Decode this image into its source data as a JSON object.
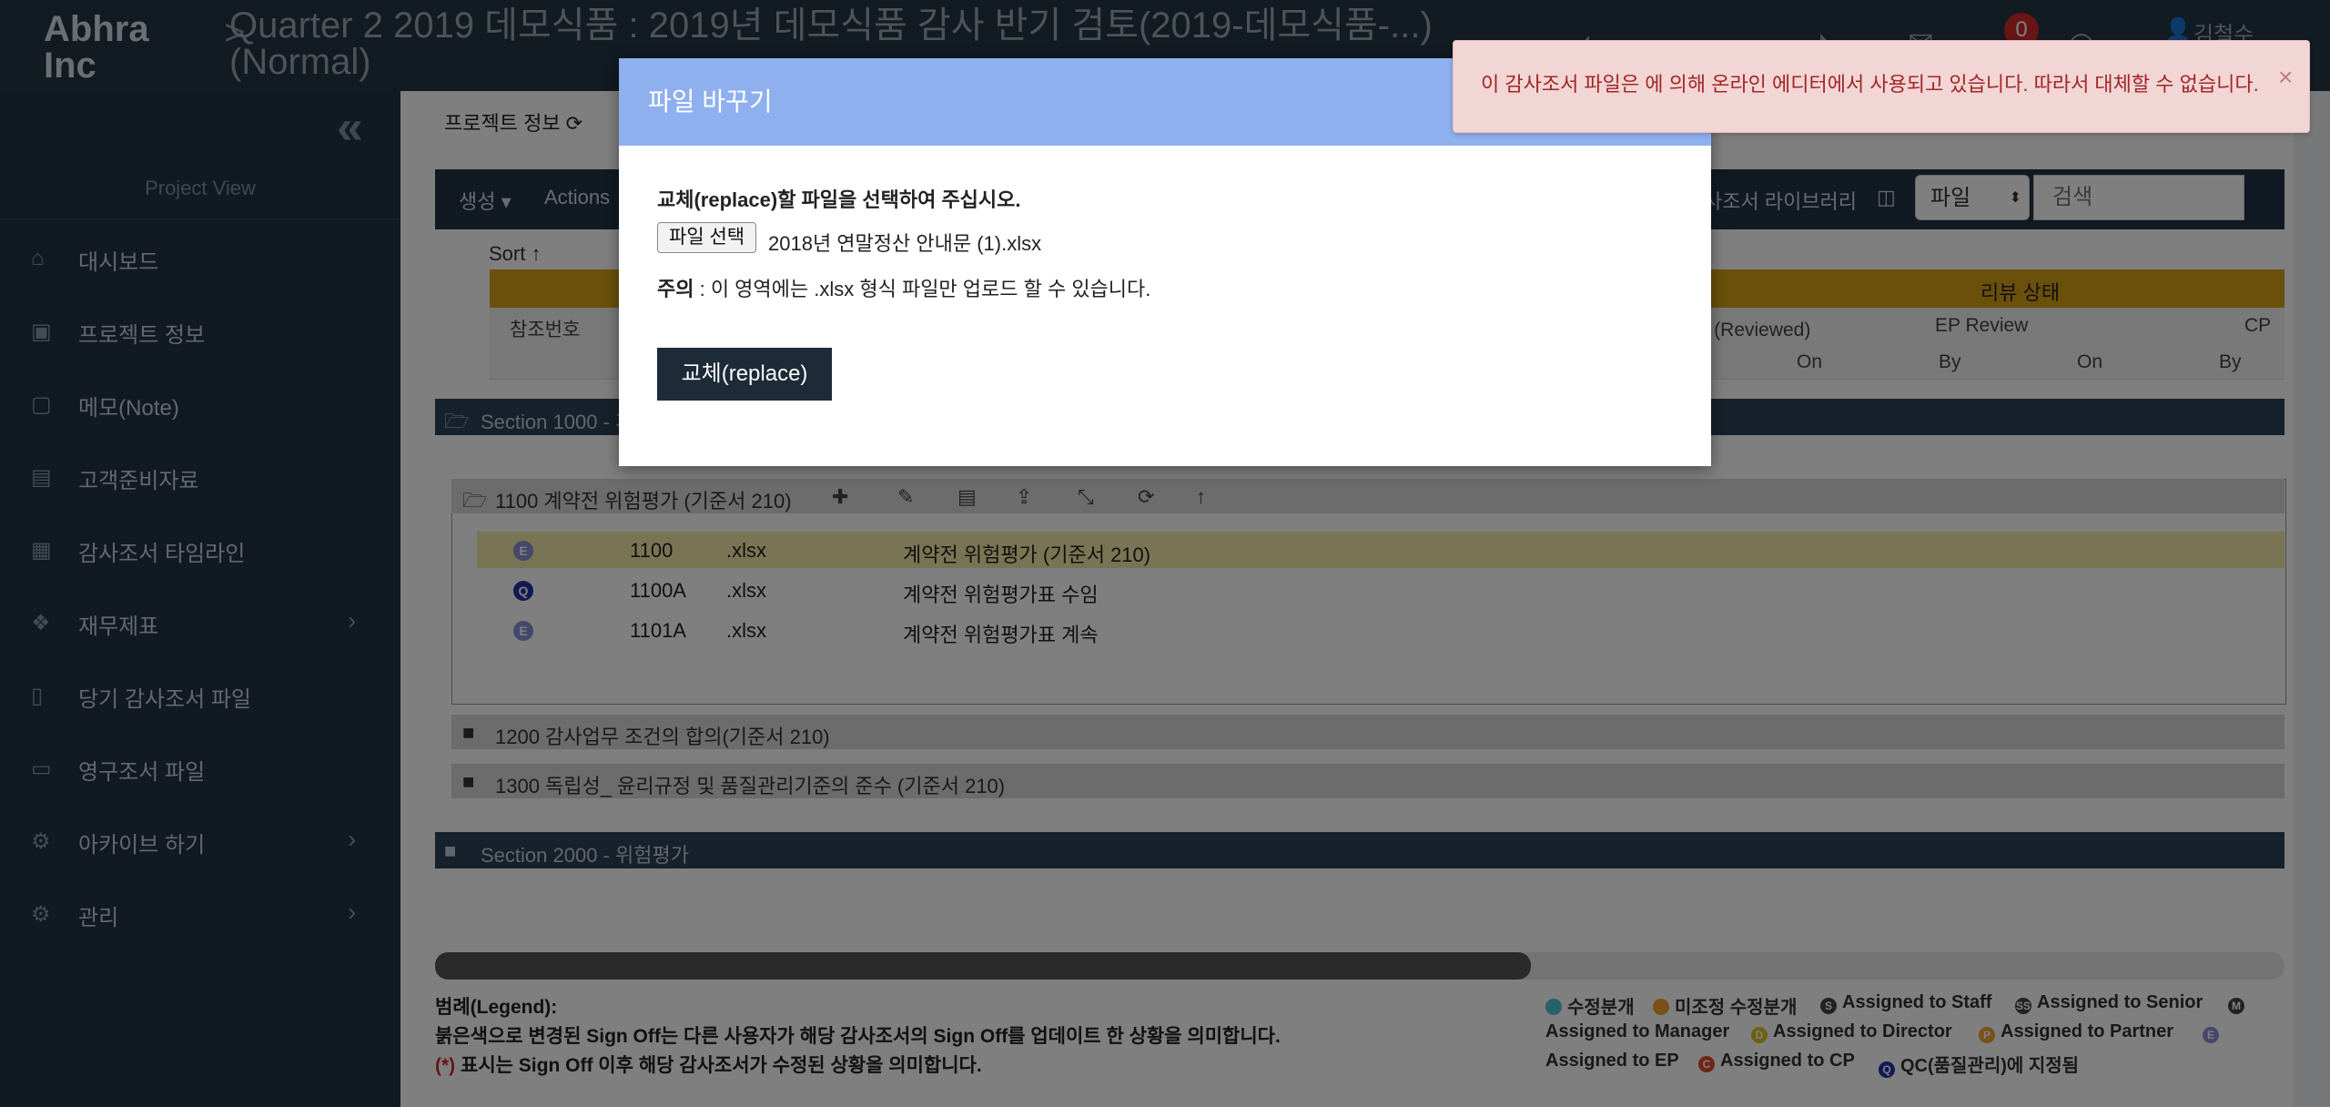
{
  "app": {
    "brand": "Abhra Inc",
    "crumb_sep": ">",
    "project_title": "Quarter 2 2019 데모식품 : 2019년 데모식품 감사 반기 검토(2019-데모식품-...) (Normal)",
    "notifications": "0",
    "user": "김철수"
  },
  "sidebar": {
    "collapse": "«",
    "view_label": "Project View",
    "items": [
      {
        "icon": "⌂",
        "label": "대시보드"
      },
      {
        "icon": "▣",
        "label": "프로젝트 정보"
      },
      {
        "icon": "▢",
        "label": "메모(Note)"
      },
      {
        "icon": "▤",
        "label": "고객준비자료"
      },
      {
        "icon": "▦",
        "label": "감사조서 타임라인"
      },
      {
        "icon": "❖",
        "label": "재무제표",
        "arrow": "›"
      },
      {
        "icon": "▯",
        "label": "당기 감사조서 파일"
      },
      {
        "icon": "▭",
        "label": "영구조서 파일"
      },
      {
        "icon": "⚙",
        "label": "아카이브 하기",
        "arrow": "›"
      },
      {
        "icon": "⚙",
        "label": "관리",
        "arrow": "›"
      }
    ]
  },
  "main": {
    "proj_info_label": "프로젝트 정보 ⟳",
    "toolbar": {
      "create": "생성 ▾",
      "actions": "Actions",
      "library": "사조서 라이브러리",
      "file_select": "파일",
      "search_placeholder": "검색"
    },
    "sort_label": "Sort ↑",
    "review_status": "리뷰 상태",
    "columns": {
      "ref": "참조번호",
      "reviewed": "료 (Reviewed)",
      "ep_review": "EP Review",
      "cp": "CP",
      "on1": "On",
      "by1": "By",
      "on2": "On",
      "by2": "By"
    },
    "section1": "Section 1000 - 계",
    "section2": "Section 2000 - 위험평가",
    "sub1": "1100 계약전 위험평가 (기준서 210)",
    "sub2": "1200 감사업무 조건의 합의(기준서 210)",
    "sub3": "1300 독립성_ 윤리규정 및 품질관리기준의 준수 (기준서 210)",
    "files": [
      {
        "badge": "E",
        "ref": "1100",
        "ext": ".xlsx",
        "name": "계약전 위험평가 (기준서 210)"
      },
      {
        "badge": "Q",
        "ref": "1100A",
        "ext": ".xlsx",
        "name": "계약전 위험평가표 수임"
      },
      {
        "badge": "E",
        "ref": "1101A",
        "ext": ".xlsx",
        "name": "계약전 위험평가표 계속"
      }
    ]
  },
  "legend": {
    "title": "범례(Legend):",
    "line1": "붉은색으로 변경된 Sign Off는 다른 사용자가 해당 감사조서의 Sign Off를 업데이트 한 상황을 의미합니다.",
    "line2_mark": "(*)",
    "line2": " 표시는 Sign Off 이후 해당 감사조서가 수정된 상황을 의미합니다.",
    "items": [
      {
        "mark": "",
        "label": "수정분개",
        "color": "#4fc3d9"
      },
      {
        "mark": "",
        "label": "미조정 수정분개",
        "color": "#f0a030"
      },
      {
        "mark": "S",
        "label": "Assigned to Staff",
        "color": "#444"
      },
      {
        "mark": "SS",
        "label": "Assigned to Senior",
        "color": "#444"
      },
      {
        "mark": "M",
        "label": "",
        "color": "#444"
      },
      {
        "mark": "",
        "label": "Assigned to Manager",
        "color": ""
      },
      {
        "mark": "D",
        "label": "Assigned to Director",
        "color": "#d9c21a"
      },
      {
        "mark": "P",
        "label": "Assigned to Partner",
        "color": "#f0a030"
      },
      {
        "mark": "E",
        "label": "",
        "color": "#8b8fd9"
      },
      {
        "mark": "",
        "label": "Assigned to EP",
        "color": ""
      },
      {
        "mark": "C",
        "label": "Assigned to CP",
        "color": "#e04a2a"
      },
      {
        "mark": "Q",
        "label": "QC(품질관리)에 지정됨",
        "color": "#2432a8"
      }
    ]
  },
  "modal": {
    "title": "파일 바꾸기",
    "instr_bold": "교체(replace)",
    "instr_rest": "할 파일을 선택하여 주십시오.",
    "choose_btn": "파일 선택",
    "chosen_file": "2018년 연말정산 안내문 (1).xlsx",
    "note_bold": "주의",
    "note_rest": " : 이 영역에는 .xlsx 형식 파일만 업로드 할 수 있습니다.",
    "replace_btn": "교체(replace)"
  },
  "toast": {
    "message": "이 감사조서 파일은 에 의해 온라인 에디터에서 사용되고 있습니다. 따라서 대체할 수 없습니다.",
    "close": "×"
  }
}
